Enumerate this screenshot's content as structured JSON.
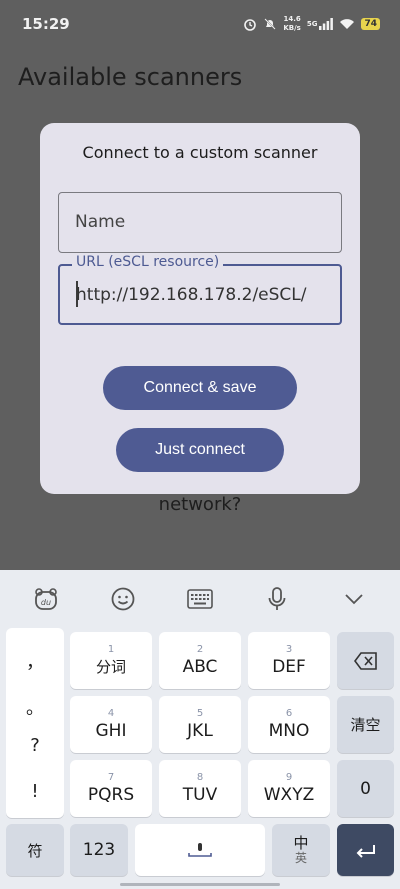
{
  "status": {
    "time": "15:29",
    "net_speed_top": "14.6",
    "net_speed_bottom": "KB/s",
    "network": "5G",
    "battery": "74"
  },
  "page": {
    "title": "Available scanners",
    "background_text": "network?"
  },
  "dialog": {
    "title": "Connect to a custom scanner",
    "name_placeholder": "Name",
    "url_label": "URL (eSCL resource)",
    "url_value": "http://192.168.178.2/eSCL/",
    "connect_save_label": "Connect & save",
    "just_connect_label": "Just connect"
  },
  "keyboard": {
    "punctuation": [
      "，",
      "。",
      "?",
      "!"
    ],
    "keys": [
      {
        "num": "1",
        "label": "分词"
      },
      {
        "num": "2",
        "label": "ABC"
      },
      {
        "num": "3",
        "label": "DEF"
      },
      {
        "num": "4",
        "label": "GHI"
      },
      {
        "num": "5",
        "label": "JKL"
      },
      {
        "num": "6",
        "label": "MNO"
      },
      {
        "num": "7",
        "label": "PQRS"
      },
      {
        "num": "8",
        "label": "TUV"
      },
      {
        "num": "9",
        "label": "WXYZ"
      }
    ],
    "clear_label": "清空",
    "zero_label": "0",
    "symbol_label": "符",
    "numbers_label": "123",
    "lang_top": "中",
    "lang_bottom": "英"
  },
  "colors": {
    "accent": "#4f5b93",
    "dialog_bg": "#e4e2ec",
    "scrim": "#5f5f5f"
  }
}
